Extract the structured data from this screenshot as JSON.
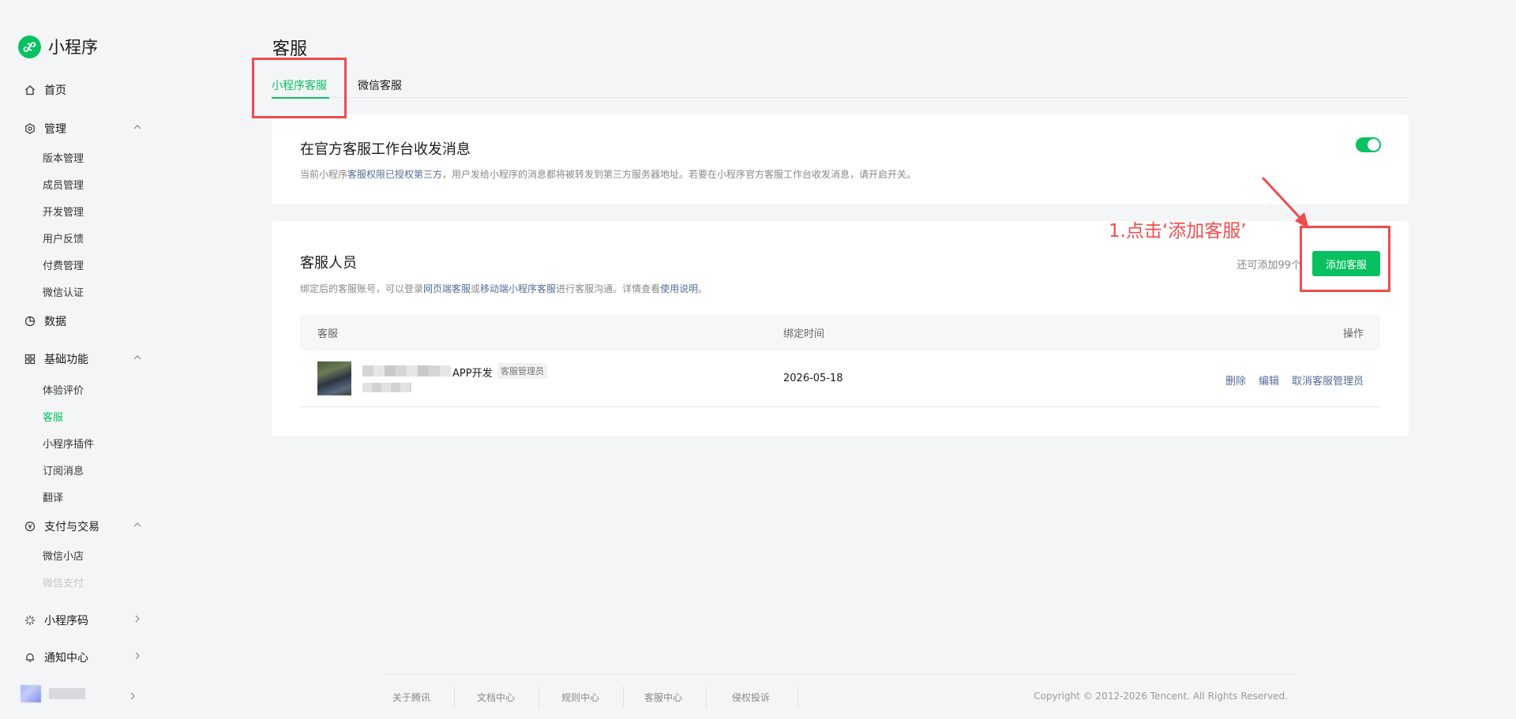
{
  "app": {
    "name": "小程序"
  },
  "sidebar": {
    "home": "首页",
    "manage": {
      "label": "管理",
      "items": [
        "版本管理",
        "成员管理",
        "开发管理",
        "用户反馈",
        "付费管理",
        "微信认证"
      ]
    },
    "data": "数据",
    "basic": {
      "label": "基础功能",
      "items": [
        "体验评价",
        "客服",
        "小程序插件",
        "订阅消息",
        "翻译"
      ]
    },
    "pay": {
      "label": "支付与交易",
      "items": [
        "微信小店",
        "微信支付"
      ]
    },
    "qrcode": "小程序码",
    "notify": "通知中心"
  },
  "page": {
    "title": "客服",
    "tabs": [
      "小程序客服",
      "微信客服"
    ]
  },
  "workbench": {
    "title": "在官方客服工作台收发消息",
    "desc_pre": "当前小程序",
    "desc_link": "客服权限已授权第三方",
    "desc_post": "，用户发给小程序的消息都将被转发到第三方服务器地址。若要在小程序官方客服工作台收发消息，请开启开关。",
    "toggle_on": true
  },
  "staff": {
    "title": "客服人员",
    "desc_1": "绑定后的客服账号，可以登录",
    "link_1": "网页端客服",
    "desc_2": "或",
    "link_2": "移动端小程序客服",
    "desc_3": "进行客服沟通。详情查看",
    "link_3": "使用说明",
    "desc_4": "。",
    "remain": "还可添加99个",
    "add_button": "添加客服",
    "columns": {
      "agent": "客服",
      "bind_time": "绑定时间",
      "ops": "操作"
    },
    "rows": [
      {
        "name_suffix": "APP开发",
        "role": "客服管理员",
        "bind_time": "2026-05-18",
        "ops": [
          "删除",
          "编辑",
          "取消客服管理员"
        ]
      }
    ]
  },
  "annotation": {
    "text": "1.点击‘添加客服’",
    "color": "#f04b4b"
  },
  "footer": {
    "links": [
      "关于腾讯",
      "文档中心",
      "规则中心",
      "客服中心",
      "侵权投诉"
    ],
    "copyright": "Copyright © 2012-2026 Tencent. All Rights Reserved."
  },
  "colors": {
    "brand": "#07c160",
    "link": "#576b95"
  }
}
